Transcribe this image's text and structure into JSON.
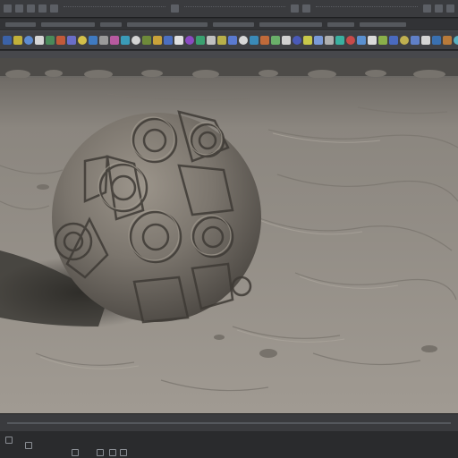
{
  "menubar": {
    "items": [
      "",
      "",
      "",
      "",
      "",
      "",
      "",
      "",
      "",
      ""
    ]
  },
  "viewport": {
    "background_color": "#8f8a83",
    "object": "carved-stone-sphere"
  },
  "shelf": {
    "tool_colors": [
      "#3b62a8",
      "#c2b13a",
      "#5d8bd1",
      "#d6d6d6",
      "#4a8a5a",
      "#c25a3a",
      "#6a6ec8",
      "#d3c04a",
      "#3f7ac1",
      "#9a9a9a",
      "#b85aa0",
      "#3a9bb8",
      "#d3d3d3",
      "#6e8a3a",
      "#c9a23a",
      "#4c6fc0",
      "#e0e0e0",
      "#8a4ac2",
      "#3aa070",
      "#c0c0c0",
      "#b8b04a",
      "#5a7ad0",
      "#d8d8d8",
      "#3a8ab8",
      "#c06a3a",
      "#6ab06a",
      "#d0d0d0",
      "#4a5ab8",
      "#c8c84a",
      "#7a9ad8",
      "#b0b0b0",
      "#3ab0a0",
      "#c84a4a",
      "#5a90d0",
      "#dadada",
      "#8ab04a",
      "#4a6ac0",
      "#c0b050",
      "#6080c8",
      "#d4d4d4",
      "#3a70b0",
      "#b87a3a",
      "#5ab0c0",
      "#cccccc"
    ]
  },
  "timeline": {
    "label": ""
  },
  "statusbar": {
    "icons": [
      "square-icon",
      "square-icon",
      "square-icon"
    ]
  }
}
